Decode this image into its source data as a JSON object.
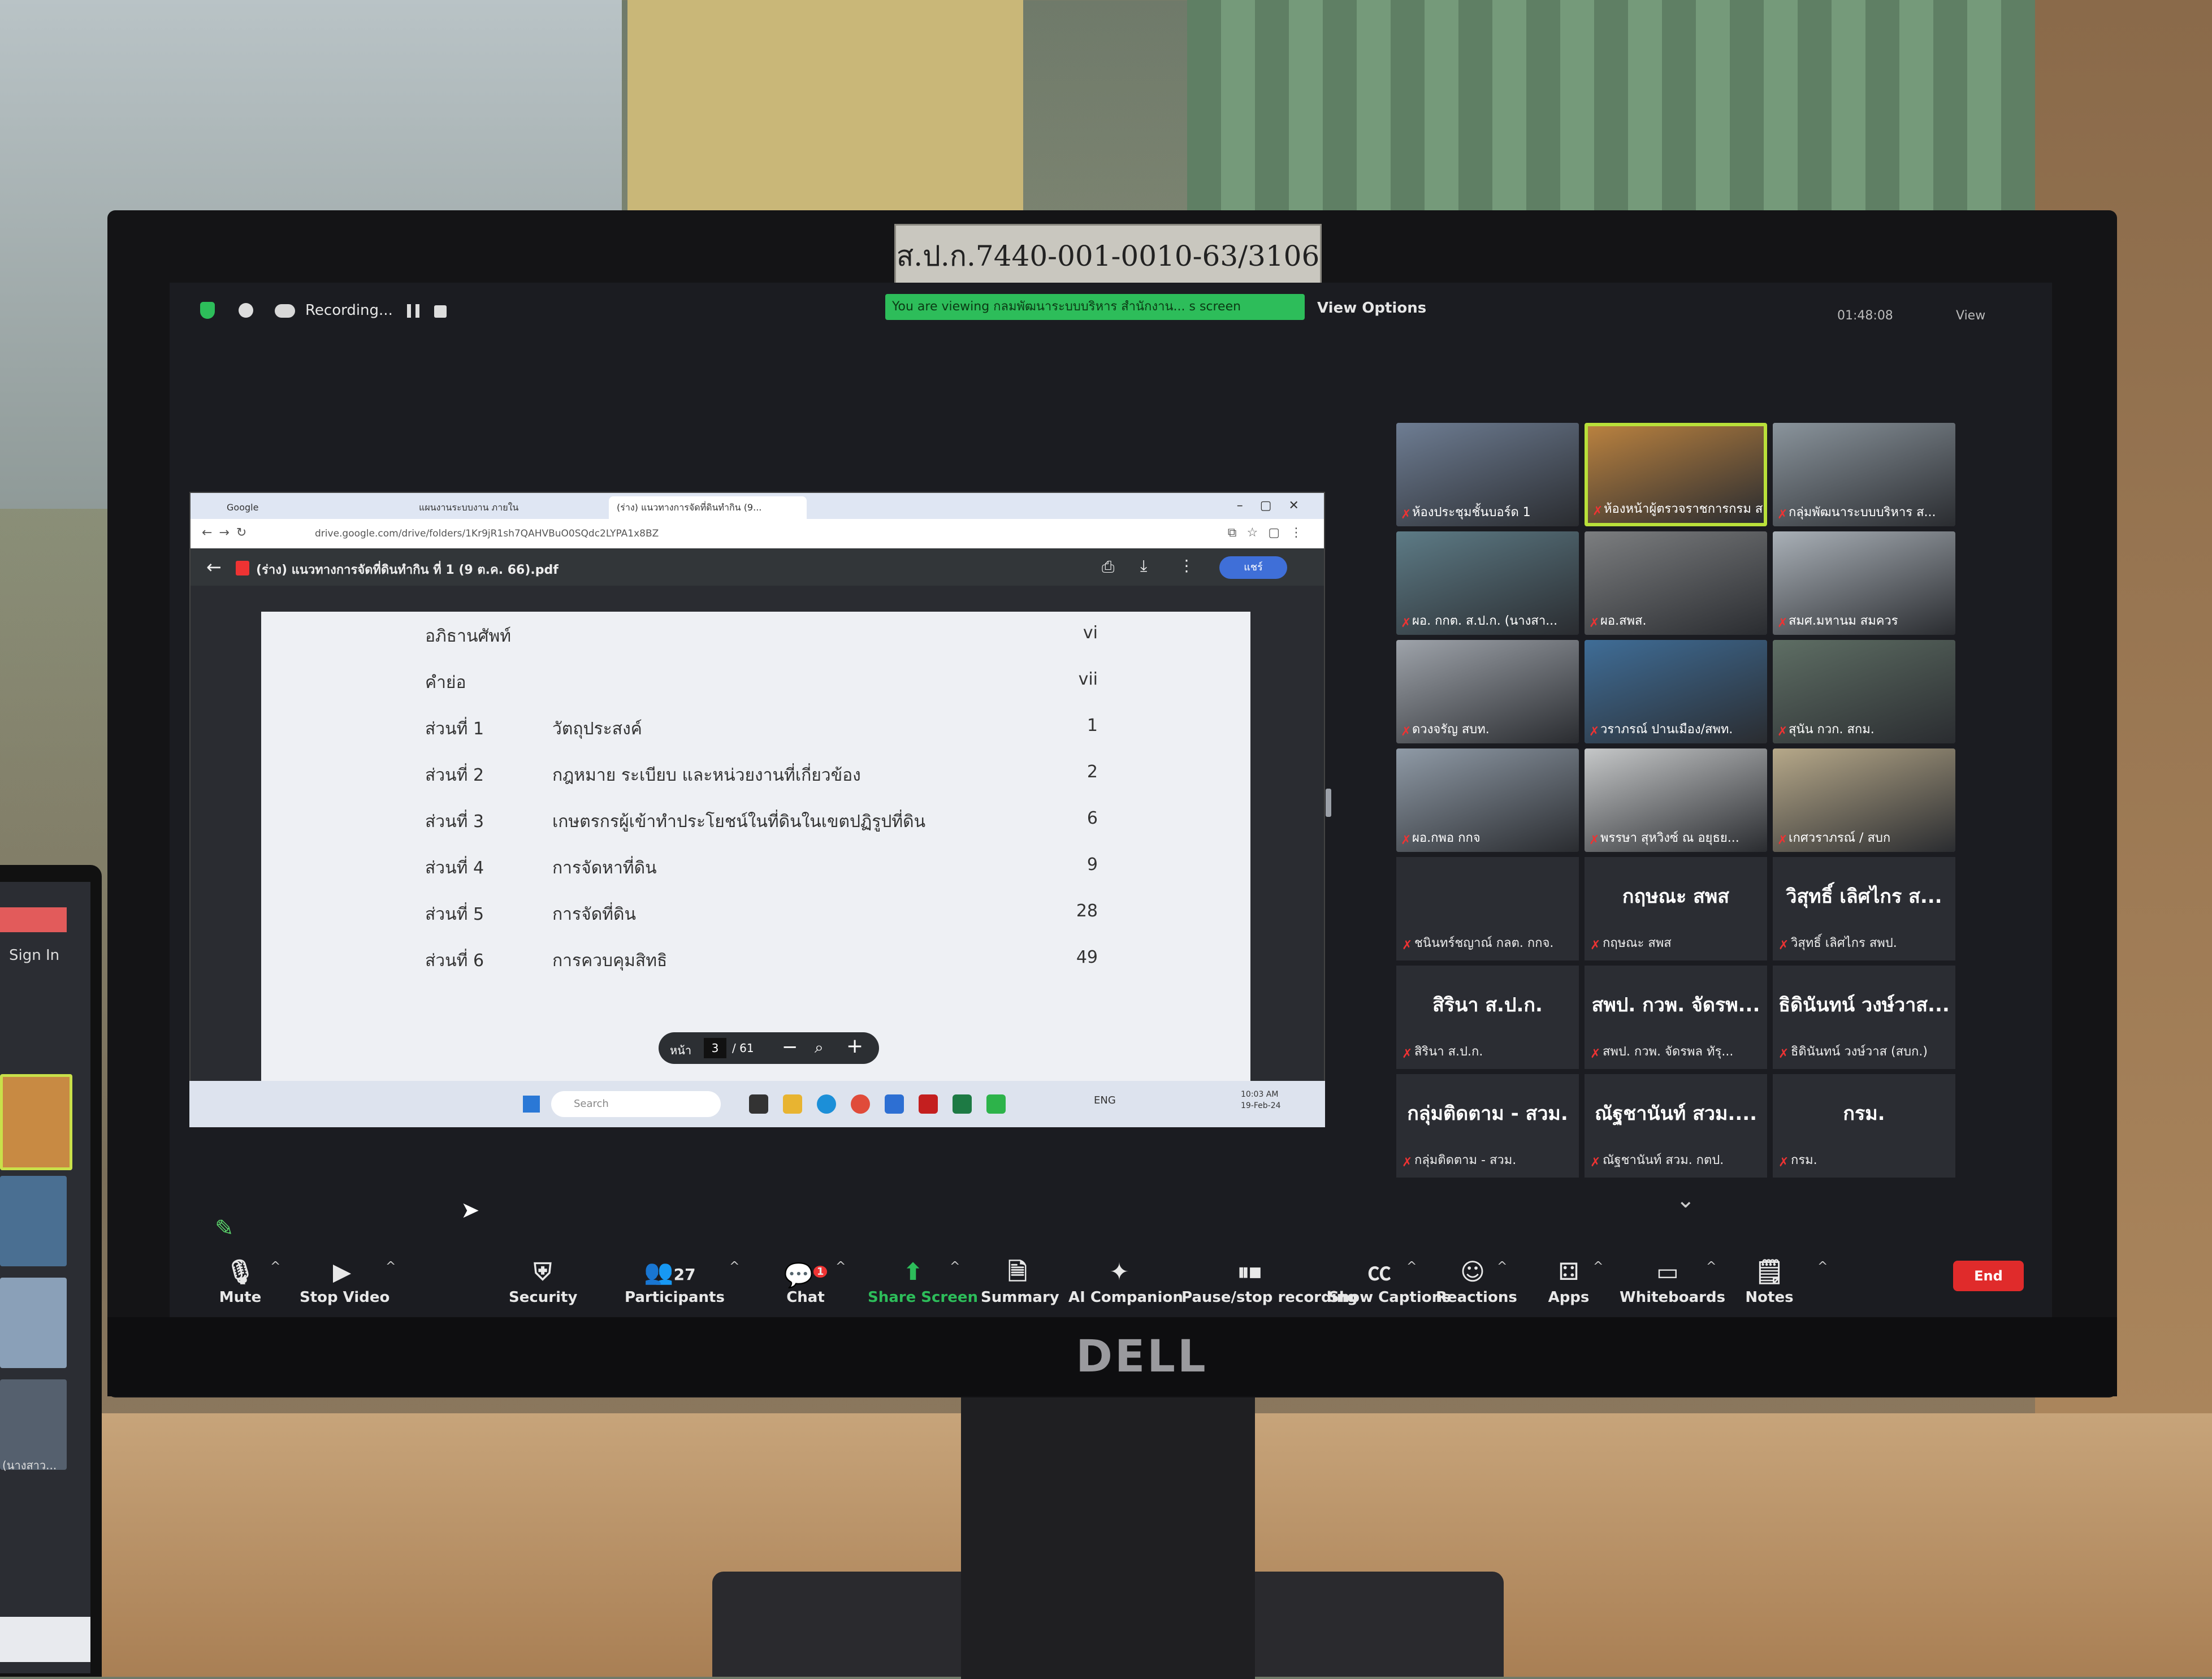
{
  "asset_tag": "ส.ป.ก.7440-001-0010-63/3106",
  "monitor_brand": "DELL",
  "zoom": {
    "topbar": {
      "recording_label": "Recording...",
      "viewing_banner": "You are viewing กลมพัฒนาระบบบริหาร สำนักงาน... s screen",
      "view_options_label": "View Options",
      "time_label": "01:48:08",
      "view_label": "View"
    },
    "shared_screen": {
      "tabs": [
        "Google",
        "แผนงานระบบงาน ภายใน",
        "(ร่าง) แนวทางการจัดที่ดินทำกิน (9..."
      ],
      "url": "drive.google.com/drive/folders/1Kr9jR1sh7QAHVBuO0SQdc2LYPA1x8BZ",
      "pdf_title": "(ร่าง) แนวทางการจัดที่ดินทำกิน ที่ 1 (9 ต.ค. 66).pdf",
      "share_label": "แชร์",
      "toc": [
        {
          "section": "อภิธานศัพท์",
          "title": "",
          "page": "vi"
        },
        {
          "section": "คำย่อ",
          "title": "",
          "page": "vii"
        },
        {
          "section": "ส่วนที่ 1",
          "title": "วัตถุประสงค์",
          "page": "1"
        },
        {
          "section": "ส่วนที่ 2",
          "title": "กฎหมาย ระเบียบ และหน่วยงานที่เกี่ยวข้อง",
          "page": "2"
        },
        {
          "section": "ส่วนที่ 3",
          "title": "เกษตรกรผู้เข้าทำประโยชน์ในที่ดินในเขตปฏิรูปที่ดิน",
          "page": "6"
        },
        {
          "section": "ส่วนที่ 4",
          "title": "การจัดหาที่ดิน",
          "page": "9"
        },
        {
          "section": "ส่วนที่ 5",
          "title": "การจัดที่ดิน",
          "page": "28"
        },
        {
          "section": "ส่วนที่ 6",
          "title": "การควบคุมสิทธิ",
          "page": "49"
        }
      ],
      "page_control": {
        "label": "หน้า",
        "current": "3",
        "total": "/  61"
      },
      "taskbar": {
        "search_placeholder": "Search",
        "tray": "ENG",
        "clock_time": "10:03 AM",
        "clock_date": "19-Feb-24"
      }
    },
    "video_tiles": [
      {
        "name": "ห้องประชุมชั้นบอร์ด 1",
        "color": "#6e7d93"
      },
      {
        "name": "ห้องหน้าผู้ตรวจราชการกรม ส...",
        "color": "#b9813f",
        "active": true
      },
      {
        "name": "กลุ่มพัฒนาระบบบริหาร ส...",
        "color": "#8a949c"
      },
      {
        "name": "ผอ. กกต. ส.ป.ก. (นางสา...",
        "color": "#5d7b86"
      },
      {
        "name": "ผอ.สพส.",
        "color": "#7c7e80"
      },
      {
        "name": "สมศ.มหานม สมควร",
        "color": "#a9b0b7"
      },
      {
        "name": "ดวงจรัญ สบท.",
        "color": "#9ea3aa"
      },
      {
        "name": "วราภรณ์ ปานเมือง/สพท.",
        "color": "#3f6d97"
      },
      {
        "name": "สุนัน กวก. สกม.",
        "color": "#5e6e64"
      },
      {
        "name": "ผอ.กพอ กกจ",
        "color": "#8f9aa6"
      },
      {
        "name": "พรรษา สุหวิงซ์ ณ อยุธย...",
        "color": "#c5c7c8"
      },
      {
        "name": "เกศวราภรณ์ / สบก",
        "color": "#b6a889"
      }
    ],
    "name_tiles": [
      {
        "big": "",
        "name": "ชนินทร์ชญาณ์ กลต. กกจ."
      },
      {
        "big": "กฤษณะ สพส",
        "name": "กฤษณะ สพส"
      },
      {
        "big": "วิสุทธิ์ เลิศไกร ส...",
        "name": "วิสุทธิ์ เลิศไกร สพป."
      },
      {
        "big": "สิรินา ส.ป.ก.",
        "name": "สิรินา ส.ป.ก."
      },
      {
        "big": "สพป. กวพ. จัดรพ...",
        "name": "สพป. กวพ. จัดรพล ทัรุ..."
      },
      {
        "big": "ธิดินันทน์ วงษ์วาส...",
        "name": "ธิดินันทน์ วงษ์วาส (สบก.)"
      },
      {
        "big": "กลุ่มติดตาม - สวม.",
        "name": "กลุ่มติดตาม - สวม."
      },
      {
        "big": "ณัฐชานันท์ สวม....",
        "name": "ณัฐชานันท์ สวม. กตป."
      },
      {
        "big": "กรม.",
        "name": "กรม."
      }
    ],
    "toolbar": {
      "mute": "Mute",
      "stop_video": "Stop Video",
      "security": "Security",
      "participants": "Participants",
      "participants_count": "27",
      "chat": "Chat",
      "chat_badge": "1",
      "share_screen": "Share Screen",
      "summary": "Summary",
      "ai_companion": "AI Companion",
      "pause_recording": "Pause/stop recording",
      "show_captions": "Show Captions",
      "reactions": "Reactions",
      "apps": "Apps",
      "whiteboards": "Whiteboards",
      "notes": "Notes",
      "end": "End"
    }
  },
  "laptop": {
    "sign_in": "Sign In",
    "tile_label": "(นางสาว..."
  }
}
